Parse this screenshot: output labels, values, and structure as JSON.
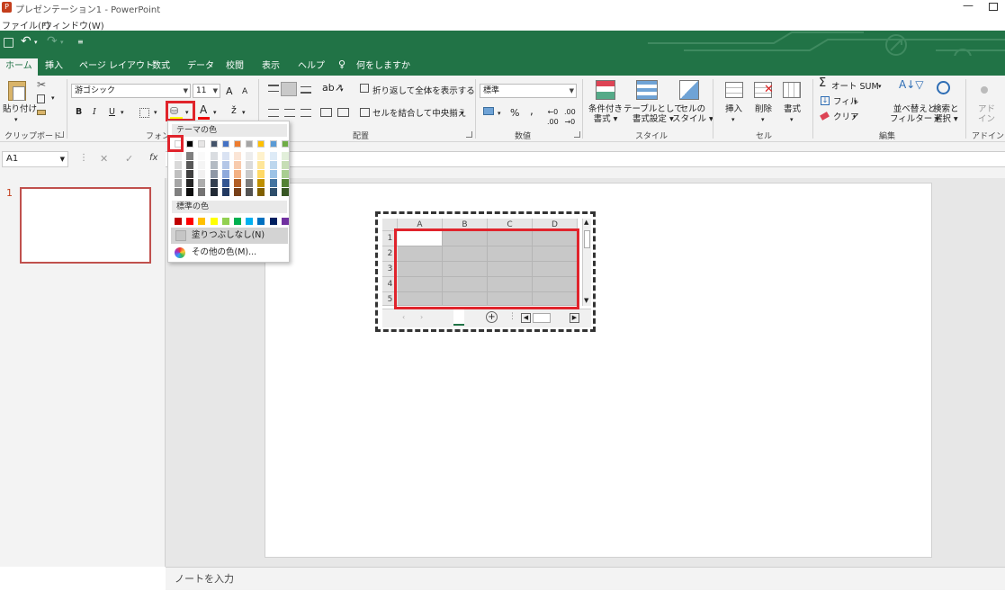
{
  "window": {
    "title": "プレゼンテーション1 - PowerPoint"
  },
  "menubar": {
    "file": "ファイル(F)",
    "window": "ウィンドウ(W)"
  },
  "tabs": [
    "ホーム",
    "挿入",
    "ページ レイアウト",
    "数式",
    "データ",
    "校閲",
    "表示",
    "ヘルプ",
    "何をしますか"
  ],
  "ribbon": {
    "clipboard": {
      "paste": "貼り付け",
      "label": "クリップボード"
    },
    "font": {
      "name": "游ゴシック",
      "size": "11",
      "bold": "B",
      "italic": "I",
      "underline": "U",
      "label": "フォント",
      "grow": "A",
      "shrink": "A",
      "font_color": "A"
    },
    "alignment": {
      "wrap": "折り返して全体を表示する",
      "merge": "セルを結合して中央揃え",
      "label": "配置"
    },
    "number": {
      "format": "標準",
      "percent": "%",
      "comma": ",",
      "label": "数値"
    },
    "styles": {
      "conditional": [
        "条件付き",
        "書式"
      ],
      "table": [
        "テーブルとして",
        "書式設定"
      ],
      "cell": [
        "セルの",
        "スタイル"
      ],
      "label": "スタイル"
    },
    "cells": {
      "insert": "挿入",
      "delete": "削除",
      "format": "書式",
      "label": "セル"
    },
    "editing": {
      "autosum": "オート SUM",
      "fill": "フィル",
      "clear": "クリア",
      "sort": [
        "並べ替えと",
        "フィルター"
      ],
      "find": [
        "検索と",
        "選択"
      ],
      "label": "編集"
    },
    "addins": {
      "addin": [
        "アド",
        "イン"
      ],
      "label": "アドイン"
    }
  },
  "formula": {
    "namebox": "A1",
    "cancel": "✕",
    "enter": "✓",
    "fx": "fx"
  },
  "slides": {
    "number": "1"
  },
  "notes": {
    "placeholder": "ノートを入力"
  },
  "sheet": {
    "columns": [
      "A",
      "B",
      "C",
      "D"
    ],
    "rows": [
      "1",
      "2",
      "3",
      "4",
      "5"
    ]
  },
  "fill_dropdown": {
    "theme_colors_label": "テーマの色",
    "standard_colors_label": "標準の色",
    "no_fill": "塗りつぶしなし(N)",
    "more_colors": "その他の色(M)...",
    "theme_top": [
      "#ffffff",
      "#000000",
      "#e7e6e6",
      "#44546a",
      "#4472c4",
      "#ed7d31",
      "#a5a5a5",
      "#ffc000",
      "#5b9bd5",
      "#70ad47"
    ],
    "standard": [
      "#c00000",
      "#ff0000",
      "#ffc000",
      "#ffff00",
      "#92d050",
      "#00b050",
      "#00b0f0",
      "#0070c0",
      "#002060",
      "#7030a0"
    ]
  },
  "colors": {
    "accent": "#217346",
    "highlight": "#e0242c"
  }
}
